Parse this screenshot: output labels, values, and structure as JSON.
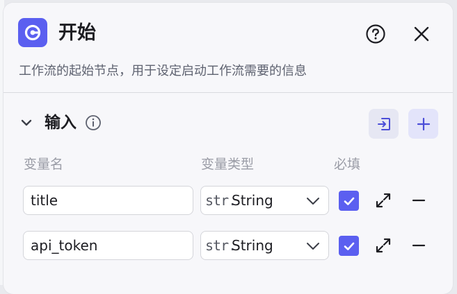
{
  "node": {
    "icon": "start-node-icon",
    "accent_color": "#5b5ff0",
    "title": "开始",
    "description": "工作流的起始节点，用于设定启动工作流需要的信息"
  },
  "header_actions": {
    "help_icon": "help-circle-icon",
    "close_icon": "close-icon"
  },
  "input_section": {
    "title": "输入",
    "expanded": true,
    "info_icon": "info-icon",
    "import_icon": "import-icon",
    "add_icon": "plus-icon"
  },
  "columns": {
    "name": "变量名",
    "type": "变量类型",
    "required": "必填"
  },
  "variables": [
    {
      "name": "title",
      "type_prefix": "str.",
      "type": "String",
      "required": true
    },
    {
      "name": "api_token",
      "type_prefix": "str.",
      "type": "String",
      "required": true
    }
  ]
}
